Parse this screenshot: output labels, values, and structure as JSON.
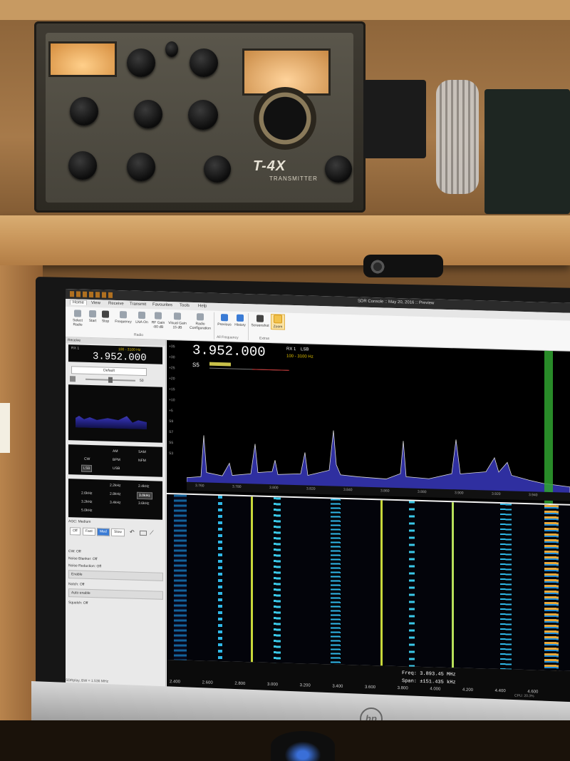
{
  "transmitter": {
    "model": "T-4X",
    "type_label": "TRANSMITTER"
  },
  "window": {
    "title": "SDR Console :: May 20, 2016 :: Preview",
    "menu": [
      "Home",
      "View",
      "Receive",
      "Transmit",
      "Favourites",
      "Tools",
      "Help"
    ],
    "ribbon": {
      "buttons": [
        "Select Radio",
        "Start",
        "Stop",
        "Frequency",
        "LNA On",
        "RF Gain -80 dB",
        "Visual Gain 15 dB",
        "Radio Configuration",
        "Previous",
        "History",
        "Screenshot",
        "Zoom"
      ],
      "groups": [
        "Radio",
        "All Frequency",
        "Extras"
      ]
    }
  },
  "left_panel": {
    "header": "Receive",
    "rx": "RX 1",
    "bandwidth": "100 - 3100 Hz",
    "frequency": "3.952.000",
    "preset": "Default",
    "volume": "50",
    "modes": [
      "AM",
      "SAM",
      "CW",
      "BPM",
      "NFM",
      "LSB",
      "USB"
    ],
    "selected_mode": "LSB",
    "bandwidths": [
      "2.2kHz",
      "2.4kHz",
      "2.6kHz",
      "2.8kHz",
      "3.0kHz",
      "3.2kHz",
      "3.4kHz",
      "3.6kHz",
      "5.0kHz"
    ],
    "selected_bandwidth": "3.0kHz",
    "agc": {
      "label": "AGC: Medium",
      "buttons": [
        "Off",
        "Fast",
        "Med",
        "Slow"
      ],
      "selected": "Med"
    },
    "options": {
      "cw": "CW: Off",
      "noise_blanker": "Noise Blanker: Off",
      "noise_reduction": "Noise Reduction: Off",
      "enable": "Enable",
      "notch": "Notch: Off",
      "auto_enable": "Auto enable",
      "squelch": "Squelch: Off"
    },
    "status": "SDRplay, BW = 1.536 MHz"
  },
  "spectrum": {
    "frequency": "3.952.000",
    "rx": "RX 1",
    "mode": "LSB",
    "bandwidth": "100 - 3100 Hz",
    "s_meter": "S5",
    "db_ticks": [
      "+35",
      "+30",
      "+25",
      "+20",
      "+15",
      "+10",
      "+5",
      "S9",
      "S7",
      "S5",
      "S3"
    ],
    "axis_ticks": [
      "3.760",
      "3.780",
      "3.800",
      "3.820",
      "3.840",
      "3.860",
      "3.880",
      "3.900",
      "3.920",
      "3.940"
    ]
  },
  "waterfall": {
    "axis_ticks": [
      "2.400",
      "2.600",
      "2.800",
      "3.000",
      "3.200",
      "3.400",
      "3.600",
      "3.800",
      "4.000",
      "4.200",
      "4.400",
      "4.600"
    ],
    "freq_readout": "Freq: 3.893.45 MHz",
    "span_readout": "Span: ±151.435 kHz",
    "cpu": "CPU: 20.3%"
  },
  "colors": {
    "spectrum_fill": "#6b5bd8",
    "marker": "#2fa32f",
    "selected": "#3a7bd5",
    "accent_yellow": "#e0c000"
  }
}
